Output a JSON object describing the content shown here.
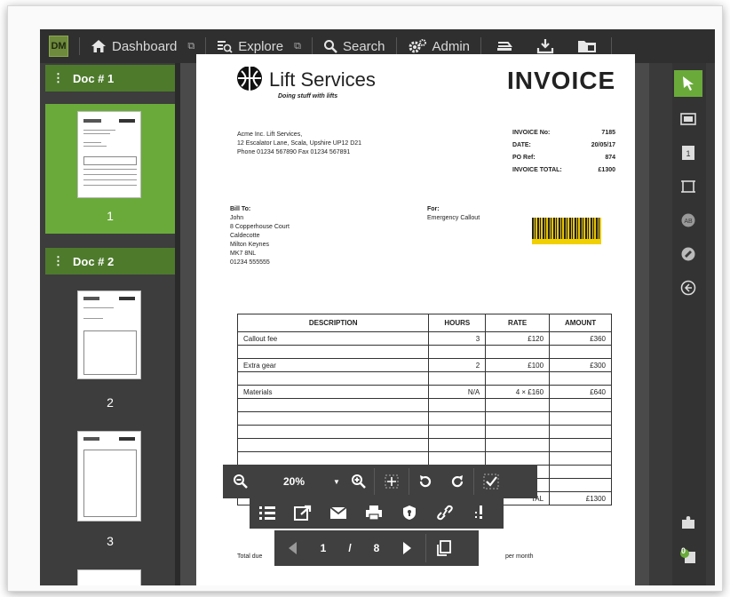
{
  "app": {
    "logo": "DM",
    "nav": [
      {
        "label": "Dashboard",
        "icon": "home-icon"
      },
      {
        "label": "Explore",
        "icon": "explore-icon"
      },
      {
        "label": "Search",
        "icon": "search-icon"
      },
      {
        "label": "Admin",
        "icon": "gear-icon"
      }
    ],
    "accent": "#6aaa3a",
    "header_green": "#4e7a2c"
  },
  "sidebar": {
    "docs": [
      {
        "label": "Doc # 1",
        "pages": [
          "1"
        ]
      },
      {
        "label": "Doc # 2",
        "pages": [
          "2",
          "3"
        ]
      }
    ]
  },
  "invoice": {
    "company": "Lift Services",
    "tagline": "Doing stuff with lifts",
    "title": "INVOICE",
    "address_lines": [
      "Acme Inc. Lift Services,",
      "12 Escalator Lane, Scala, Upshire UP12 D21",
      "Phone 01234 567890  Fax 01234 567891"
    ],
    "meta": [
      {
        "label": "INVOICE No:",
        "value": "7185"
      },
      {
        "label": "DATE:",
        "value": "20/05/17"
      },
      {
        "label": "PO Ref:",
        "value": "874"
      },
      {
        "label": "INVOICE TOTAL:",
        "value": "£1300"
      }
    ],
    "bill_to_label": "Bill To:",
    "bill_to_lines": [
      "John",
      "8 Copperhouse Court",
      "Caldecotte",
      "Milton Keynes",
      "MK7 8NL",
      "01234 555555"
    ],
    "for_label": "For:",
    "for_value": "Emergency Callout",
    "table_headers": [
      "DESCRIPTION",
      "HOURS",
      "RATE",
      "AMOUNT"
    ],
    "rows": [
      {
        "description": "Callout fee",
        "hours": "3",
        "rate": "£120",
        "amount": "£360"
      },
      {
        "description": "Extra gear",
        "hours": "2",
        "rate": "£100",
        "amount": "£300"
      },
      {
        "description": "Materials",
        "hours": "N/A",
        "rate": "4 × £160",
        "amount": "£640"
      }
    ],
    "total_label_fragment": "TAL",
    "total_value": "£1300",
    "footer_fragment": "Total due",
    "footer_fragment2": "per month"
  },
  "zoom_toolbar": {
    "zoom": "20%",
    "zoom_arrow": "▼"
  },
  "pager": {
    "current": "1",
    "slash": "/",
    "total": "8"
  },
  "right_badge": "0"
}
